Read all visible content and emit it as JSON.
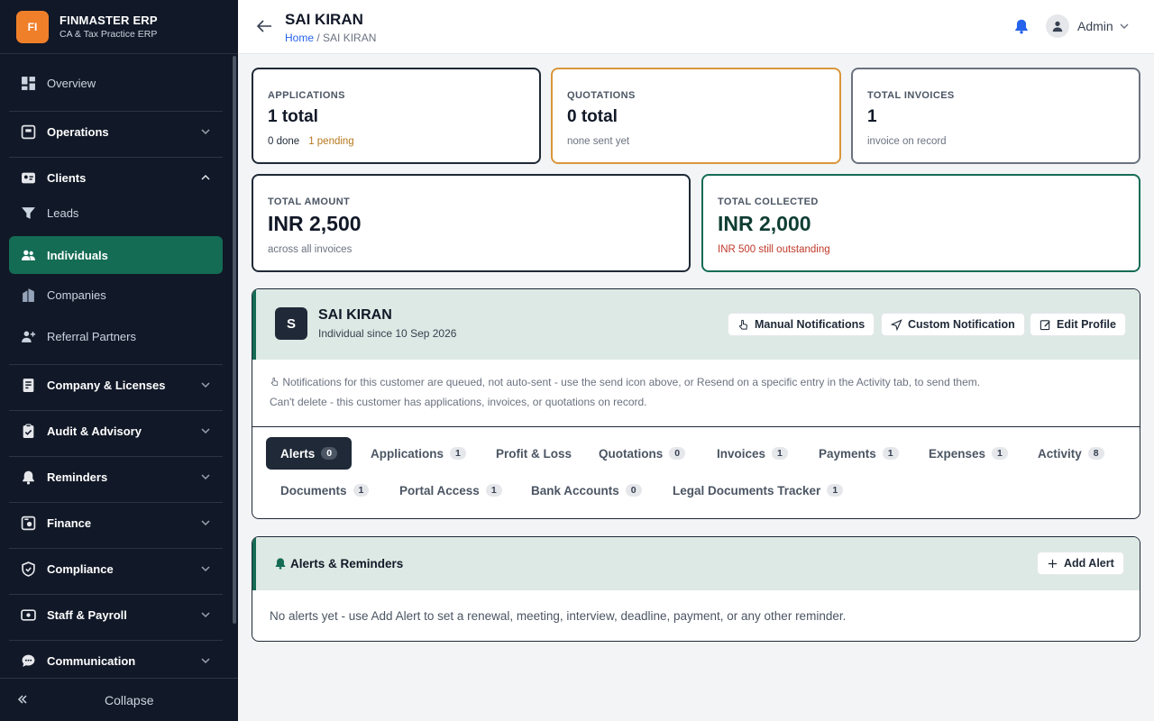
{
  "brand": {
    "logo_text": "FI",
    "name": "FINMASTER ERP",
    "subtitle": "CA & Tax Practice ERP"
  },
  "sidebar": {
    "items": [
      {
        "label": "Overview"
      },
      {
        "label": "Operations"
      },
      {
        "label": "Clients"
      },
      {
        "label": "Leads"
      },
      {
        "label": "Individuals"
      },
      {
        "label": "Companies"
      },
      {
        "label": "Referral Partners"
      },
      {
        "label": "Company & Licenses"
      },
      {
        "label": "Audit & Advisory"
      },
      {
        "label": "Reminders"
      },
      {
        "label": "Finance"
      },
      {
        "label": "Compliance"
      },
      {
        "label": "Staff & Payroll"
      },
      {
        "label": "Communication"
      }
    ],
    "collapse_label": "Collapse"
  },
  "header": {
    "title": "SAI KIRAN",
    "breadcrumb_home": "Home",
    "breadcrumb_sep": " / ",
    "breadcrumb_current": "SAI KIRAN",
    "user": "Admin"
  },
  "stats": {
    "applications": {
      "label": "APPLICATIONS",
      "value": "1 total",
      "done": "0 done",
      "pending": "1 pending"
    },
    "quotations": {
      "label": "QUOTATIONS",
      "value": "0 total",
      "sub": "none sent yet"
    },
    "invoices": {
      "label": "TOTAL INVOICES",
      "value": "1",
      "sub": "invoice on record"
    },
    "amount": {
      "label": "TOTAL AMOUNT",
      "value": "INR 2,500",
      "sub": "across all invoices"
    },
    "collected": {
      "label": "TOTAL COLLECTED",
      "value": "INR 2,000",
      "sub": "INR 500 still outstanding"
    }
  },
  "profile": {
    "initial": "S",
    "name": "SAI KIRAN",
    "since": "Individual since 10 Sep 2026",
    "buttons": {
      "manual": "Manual Notifications",
      "custom": "Custom Notification",
      "edit": "Edit Profile"
    },
    "notice": "Notifications for this customer are queued, not auto-sent - use the send icon above, or Resend on a specific entry in the Activity tab, to send them.",
    "notice2": "Can't delete - this customer has applications, invoices, or quotations on record."
  },
  "tabs": [
    {
      "label": "Alerts",
      "count": "0"
    },
    {
      "label": "Applications",
      "count": "1"
    },
    {
      "label": "Profit & Loss",
      "count": ""
    },
    {
      "label": "Quotations",
      "count": "0"
    },
    {
      "label": "Invoices",
      "count": "1"
    },
    {
      "label": "Payments",
      "count": "1"
    },
    {
      "label": "Expenses",
      "count": "1"
    },
    {
      "label": "Activity",
      "count": "8"
    },
    {
      "label": "Documents",
      "count": "1"
    },
    {
      "label": "Portal Access",
      "count": "1"
    },
    {
      "label": "Bank Accounts",
      "count": "0"
    },
    {
      "label": "Legal Documents Tracker",
      "count": "1"
    }
  ],
  "alerts": {
    "title": "Alerts & Reminders",
    "add_label": "Add Alert",
    "empty": "No alerts yet - use Add Alert to set a renewal, meeting, interview, deadline, payment, or any other reminder."
  },
  "colors": {
    "accent": "#146c55",
    "brand": "#f07f2a",
    "sidebar": "#111827",
    "pending": "#b7791f",
    "outstanding": "#c0392b",
    "quotations_border": "#d9963a",
    "collected_border": "#146c55"
  }
}
